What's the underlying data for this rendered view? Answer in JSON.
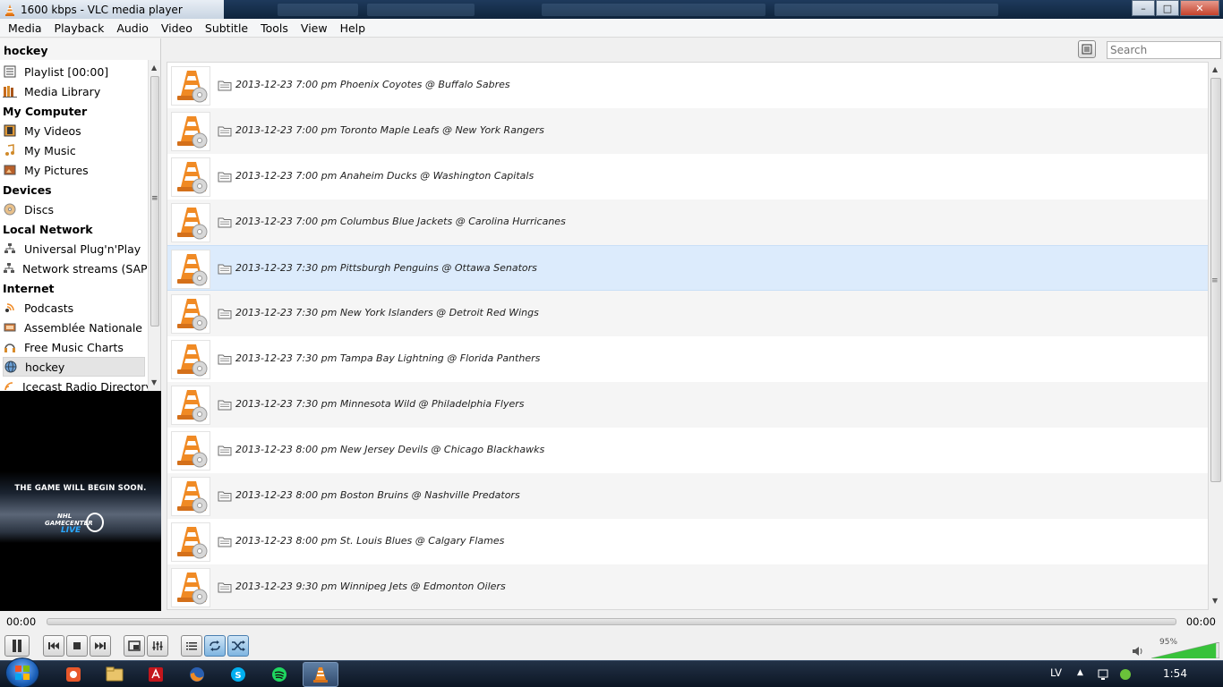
{
  "window": {
    "title": "1600 kbps - VLC media player",
    "minimize": "–",
    "maximize": "□",
    "close": "✕"
  },
  "menu": [
    "Media",
    "Playback",
    "Audio",
    "Video",
    "Subtitle",
    "Tools",
    "View",
    "Help"
  ],
  "sidebar": {
    "title": "hockey",
    "sections": [
      {
        "type": "item",
        "label": "Playlist [00:00]",
        "icon": "playlist-icon"
      },
      {
        "type": "item",
        "label": "Media Library",
        "icon": "media-library-icon"
      },
      {
        "type": "header",
        "label": "My Computer"
      },
      {
        "type": "item",
        "label": "My Videos",
        "icon": "film-icon"
      },
      {
        "type": "item",
        "label": "My Music",
        "icon": "music-note-icon"
      },
      {
        "type": "item",
        "label": "My Pictures",
        "icon": "picture-icon"
      },
      {
        "type": "header",
        "label": "Devices"
      },
      {
        "type": "item",
        "label": "Discs",
        "icon": "disc-icon"
      },
      {
        "type": "header",
        "label": "Local Network"
      },
      {
        "type": "item",
        "label": "Universal Plug'n'Play",
        "icon": "network-icon"
      },
      {
        "type": "item",
        "label": "Network streams (SAP)",
        "icon": "network-icon"
      },
      {
        "type": "header",
        "label": "Internet"
      },
      {
        "type": "item",
        "label": "Podcasts",
        "icon": "podcast-icon"
      },
      {
        "type": "item",
        "label": "Assemblée Nationale",
        "icon": "tv-icon"
      },
      {
        "type": "item",
        "label": "Free Music Charts",
        "icon": "headphones-icon"
      },
      {
        "type": "item",
        "label": "hockey",
        "icon": "globe-icon",
        "selected": true
      },
      {
        "type": "item",
        "label": "Icecast Radio Directory",
        "icon": "radio-icon"
      }
    ]
  },
  "video_preview": {
    "message": "THE GAME WILL BEGIN SOON.",
    "logo_line1": "NHL",
    "logo_line2": "GAMECENTER",
    "logo_line3": "LIVE"
  },
  "search": {
    "placeholder": "Search"
  },
  "playlist": [
    {
      "title": "2013-12-23 7:00 pm Phoenix Coyotes @ Buffalo Sabres"
    },
    {
      "title": "2013-12-23 7:00 pm Toronto Maple Leafs @ New York Rangers"
    },
    {
      "title": "2013-12-23 7:00 pm Anaheim Ducks @ Washington Capitals"
    },
    {
      "title": "2013-12-23 7:00 pm Columbus Blue Jackets @ Carolina Hurricanes"
    },
    {
      "title": "2013-12-23 7:30 pm Pittsburgh Penguins @ Ottawa Senators",
      "selected": true
    },
    {
      "title": "2013-12-23 7:30 pm New York Islanders @ Detroit Red Wings"
    },
    {
      "title": "2013-12-23 7:30 pm Tampa Bay Lightning @ Florida Panthers"
    },
    {
      "title": "2013-12-23 7:30 pm Minnesota Wild @ Philadelphia Flyers"
    },
    {
      "title": "2013-12-23 8:00 pm New Jersey Devils @ Chicago Blackhawks"
    },
    {
      "title": "2013-12-23 8:00 pm Boston Bruins @ Nashville Predators"
    },
    {
      "title": "2013-12-23 8:00 pm St. Louis Blues @ Calgary Flames"
    },
    {
      "title": "2013-12-23 9:30 pm Winnipeg Jets @ Edmonton Oilers"
    }
  ],
  "seek": {
    "elapsed": "00:00",
    "total": "00:00"
  },
  "volume": {
    "label": "95%",
    "level": 0.95
  },
  "taskbar": {
    "apps": [
      "av-app-icon",
      "explorer-icon",
      "acrobat-icon",
      "firefox-icon",
      "skype-icon",
      "spotify-icon",
      "vlc-icon"
    ],
    "active_app": "vlc-icon",
    "language": "LV",
    "clock": "1:54"
  },
  "colors": {
    "vlc_orange": "#f08a24",
    "selected_row": "#dcebfc",
    "volume_green": "#38c23a"
  }
}
